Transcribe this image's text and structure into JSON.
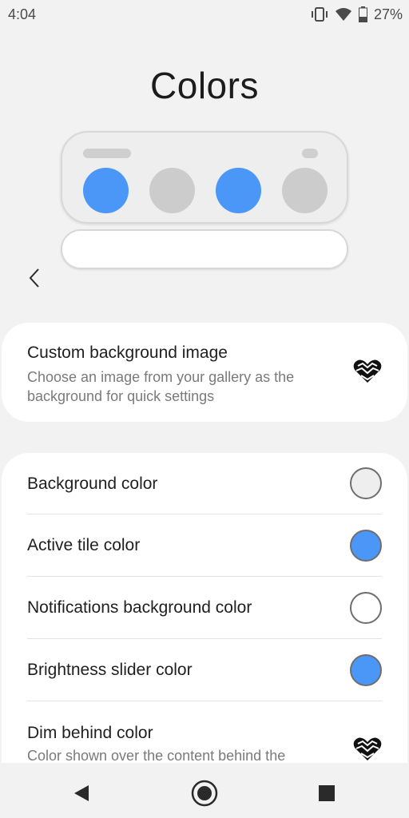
{
  "status_bar": {
    "time": "4:04",
    "battery": "27%",
    "icons": [
      "vibrate-icon",
      "wifi-icon",
      "battery-icon"
    ]
  },
  "page": {
    "title": "Colors"
  },
  "preview": {
    "circle_colors": [
      "#4a97f7",
      "#cccccc",
      "#4a97f7",
      "#cccccc"
    ]
  },
  "custom_bg": {
    "title": "Custom background image",
    "subtitle": "Choose an image from your gallery as the background for quick settings",
    "icon": "premium-heart-icon"
  },
  "settings": [
    {
      "label": "Background color",
      "swatch": "#eeeeee"
    },
    {
      "label": "Active tile color",
      "swatch": "#4a97f7"
    },
    {
      "label": "Notifications background color",
      "swatch": "#ffffff"
    },
    {
      "label": "Brightness slider color",
      "swatch": "#4a97f7"
    }
  ],
  "dim_behind": {
    "title": "Dim behind color",
    "subtitle": "Color shown over the content behind the",
    "icon": "premium-heart-icon"
  },
  "nav": {
    "icons": [
      "back-icon",
      "home-icon",
      "recents-icon"
    ]
  },
  "colors": {
    "accent": "#4a97f7",
    "background": "#f2f2f2",
    "card": "#ffffff"
  }
}
